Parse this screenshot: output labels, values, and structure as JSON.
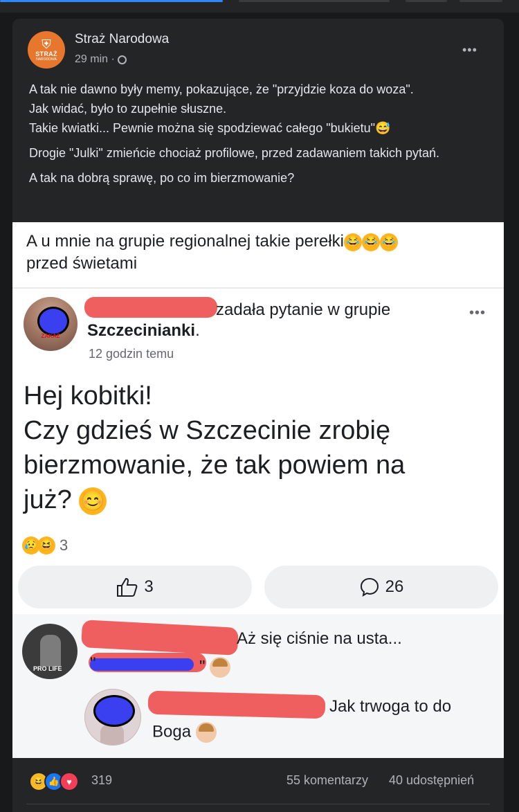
{
  "post": {
    "author": "Straż Narodowa",
    "avatar_text": "STRAŻ",
    "avatar_subtext": "NARODOWA",
    "time": "29 min ·",
    "more_label": "•••",
    "paragraphs": [
      "A tak nie dawno były memy, pokazujące, że \"przyjdzie koza do woza\".",
      "Jak widać, było to zupełnie słuszne.",
      "Takie kwiatki... Pewnie można się spodziewać całego \"bukietu\"😅",
      "Drogie \"Julki\" zmieńcie chociaż profilowe, przed zadawaniem takich pytań.",
      "A tak na dobrą sprawę, po co im bierzmowanie?"
    ]
  },
  "screenshot": {
    "caption_line1": "A u mnie na grupie regionalnej takie perełki",
    "caption_line2": "przed świetami",
    "caption_emoji": "😂",
    "inner_post": {
      "action": "zadała pytanie  w grupie",
      "group": "Szczecinianki",
      "group_suffix": ".",
      "time": "12 godzin temu",
      "more_label": "•••",
      "avatar_stamp": "ZAKAZ",
      "question_line1": "Hej kobitki!",
      "question_line2": "Czy gdzieś w Szczecinie zrobię",
      "question_line3": "bierzmowanie, że tak powiem na",
      "question_line4": "już?",
      "question_emoji": "😊",
      "reaction_count": "3",
      "like_count": "3",
      "comment_count": "26"
    },
    "comments": [
      {
        "text": "Aż się ciśnie na usta...",
        "quote_open": "\"",
        "quote_close": "\"",
        "avatar_label": "PRO LIFE"
      },
      {
        "text": "Jak trwoga to do",
        "line2": "Boga"
      }
    ]
  },
  "footer": {
    "reaction_count": "319",
    "comments_label": "55 komentarzy",
    "shares_label": "40 udostępnień"
  },
  "colors": {
    "background": "#18191a",
    "card": "#242526",
    "text_primary": "#e4e6eb",
    "text_secondary": "#b0b3b8",
    "avatar_orange": "#e8772e",
    "redaction_red": "#ef5f5f",
    "redaction_blue": "#3a3ff0",
    "like_blue": "#1877f2",
    "love_red": "#f33e58"
  },
  "icons": [
    "shield-logo-icon",
    "globe-icon",
    "more-icon",
    "thumbs-up-icon",
    "comment-bubble-icon",
    "haha-icon",
    "sad-icon",
    "like-icon",
    "love-icon",
    "shrug-emoji-icon"
  ]
}
